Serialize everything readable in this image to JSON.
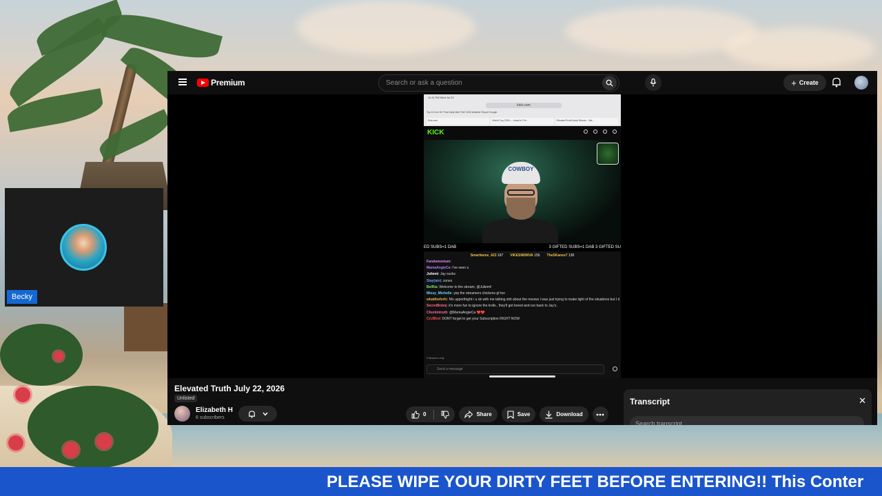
{
  "youtube": {
    "brand": "Premium",
    "search_placeholder": "Search or ask a question",
    "create_label": "Create",
    "video": {
      "title": "Elevated Truth July 22, 2026",
      "visibility": "Unlisted",
      "channel_name": "Elizabeth H",
      "subscribers": "6 subscribers",
      "like_count": "0",
      "share_label": "Share",
      "save_label": "Save",
      "download_label": "Download"
    },
    "transcript": {
      "title": "Transcript",
      "search_placeholder": "Search transcript"
    }
  },
  "stream": {
    "status_time": "11:11 PM  Wed Jul 22",
    "url": "kick.com",
    "bookmarks": "Top 10 Live   NY Post   Daily Mail   TMZ   CNN   Weather Report   Google",
    "tabs": [
      "Kick.com",
      "World Cup 2026 — Israel in Pot...",
      "ElevatedTruthSocial Stream - Wa..."
    ],
    "kick_logo": "KICK",
    "cap_text": "COWBOY",
    "goal_left": "ED SUBS=1 DAB",
    "goal_right": "3 GIFTED SUBS=1 DAB 3 GIFTED SU",
    "pinned": [
      {
        "user": "Smartiwme_423",
        "count": "197"
      },
      {
        "user": "VIKES989NVA",
        "count": "155"
      },
      {
        "user": "TheSKanes7",
        "count": "130"
      }
    ],
    "chat": [
      {
        "user": "Fandomonium",
        "color": "#e88bff",
        "text": ""
      },
      {
        "user": "MamaAngieCa",
        "color": "#a982ff",
        "text": "I've seen u"
      },
      {
        "user": "Juliemi",
        "color": "#ffffff",
        "text": "Jay sucks"
      },
      {
        "user": "Stay(ain)",
        "color": "#5aa7ff",
        "text": "zones"
      },
      {
        "user": "BelRia",
        "color": "#7de37d",
        "text": "Welcome to the stream, @Juliemi!"
      },
      {
        "user": "Missy_Michelle",
        "color": "#67d6ff",
        "text": "yep the streamers chickens gf too"
      },
      {
        "user": "whattheforfc",
        "color": "#f0b44c",
        "text": "Mo upperthight r u ok with me talking shit about the meows I was just trying to make light of the situations but I did it at the wrong time I'm sorry for that"
      },
      {
        "user": "SecretBoboj",
        "color": "#ff6a8a",
        "text": "it's more fun to ignore the trolls.. they'll get bored and run back to Jay's."
      },
      {
        "user": "Chorkintruth",
        "color": "#ff6aa0",
        "text": "@MamaAngieCa ❤️❤️"
      },
      {
        "user": "CriJBird",
        "color": "#ff4d4d",
        "text": "DONT forget to get your Subscription RIGHT NOW"
      }
    ],
    "followers_note": "Followers only",
    "send_placeholder": "Send a message"
  },
  "webcam": {
    "name": "Becky"
  },
  "ticker": {
    "text": "PLEASE WIPE YOUR DIRTY FEET BEFORE ENTERING!! This Conter"
  },
  "colors": {
    "youtube_red": "#ff0000",
    "kick_green": "#53fc18",
    "ticker_blue": "#1a55cc",
    "name_tag_blue": "#1468d4"
  }
}
